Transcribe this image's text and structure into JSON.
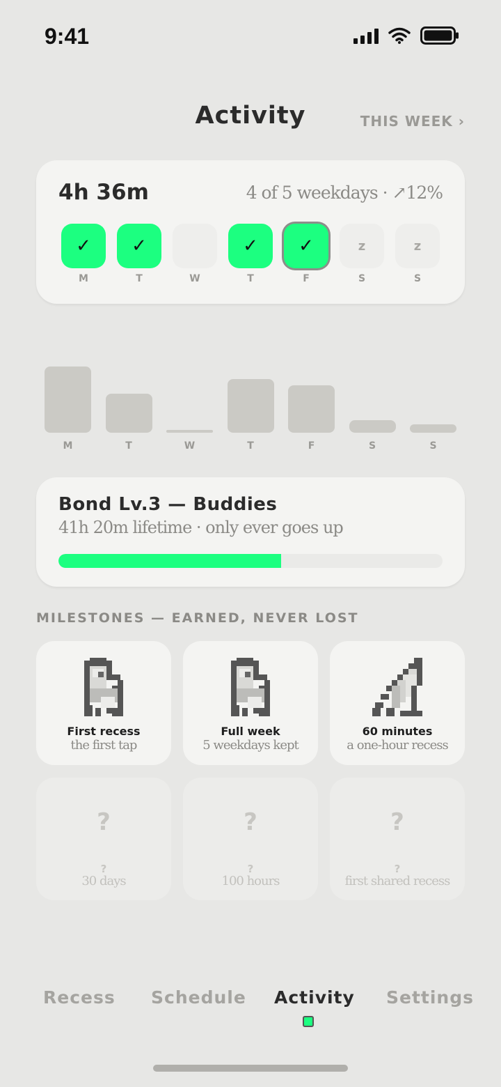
{
  "status": {
    "time": "9:41"
  },
  "header": {
    "title": "Activity",
    "range_link": "THIS WEEK ›"
  },
  "week": {
    "total": "4h 36m",
    "summary": "4 of 5 weekdays · ↗12%",
    "days": [
      {
        "label": "M",
        "state": "done",
        "mark": "✓"
      },
      {
        "label": "T",
        "state": "done",
        "mark": "✓"
      },
      {
        "label": "W",
        "state": "empty",
        "mark": ""
      },
      {
        "label": "T",
        "state": "done",
        "mark": "✓"
      },
      {
        "label": "F",
        "state": "done-today",
        "mark": "✓"
      },
      {
        "label": "S",
        "state": "rest",
        "mark": "z"
      },
      {
        "label": "S",
        "state": "rest",
        "mark": "z"
      }
    ]
  },
  "chart_data": {
    "type": "bar",
    "categories": [
      "M",
      "T",
      "W",
      "T",
      "F",
      "S",
      "S"
    ],
    "values": [
      95,
      56,
      4,
      77,
      68,
      18,
      12
    ],
    "color": "#cbcac5"
  },
  "bond": {
    "title": "Bond Lv.3 — Buddies",
    "subtitle": "41h 20m lifetime · only ever goes up",
    "progress": 0.58,
    "accent": "#1cff80"
  },
  "milestones": {
    "heading": "MILESTONES — EARNED, NEVER LOST",
    "earned": [
      {
        "name": "First recess",
        "desc": "the first tap",
        "icon": "pixel-creature-icon"
      },
      {
        "name": "Full week",
        "desc": "5 weekdays kept",
        "icon": "pixel-creature-icon"
      },
      {
        "name": "60 minutes",
        "desc": "a one-hour recess",
        "icon": "pixel-wedge-icon"
      }
    ],
    "locked": [
      {
        "symbol": "?",
        "name": "?",
        "desc": "30 days"
      },
      {
        "symbol": "?",
        "name": "?",
        "desc": "100 hours"
      },
      {
        "symbol": "?",
        "name": "?",
        "desc": "first shared recess"
      }
    ]
  },
  "tabs": [
    {
      "label": "Recess",
      "active": false
    },
    {
      "label": "Schedule",
      "active": false
    },
    {
      "label": "Activity",
      "active": true
    },
    {
      "label": "Settings",
      "active": false
    }
  ]
}
